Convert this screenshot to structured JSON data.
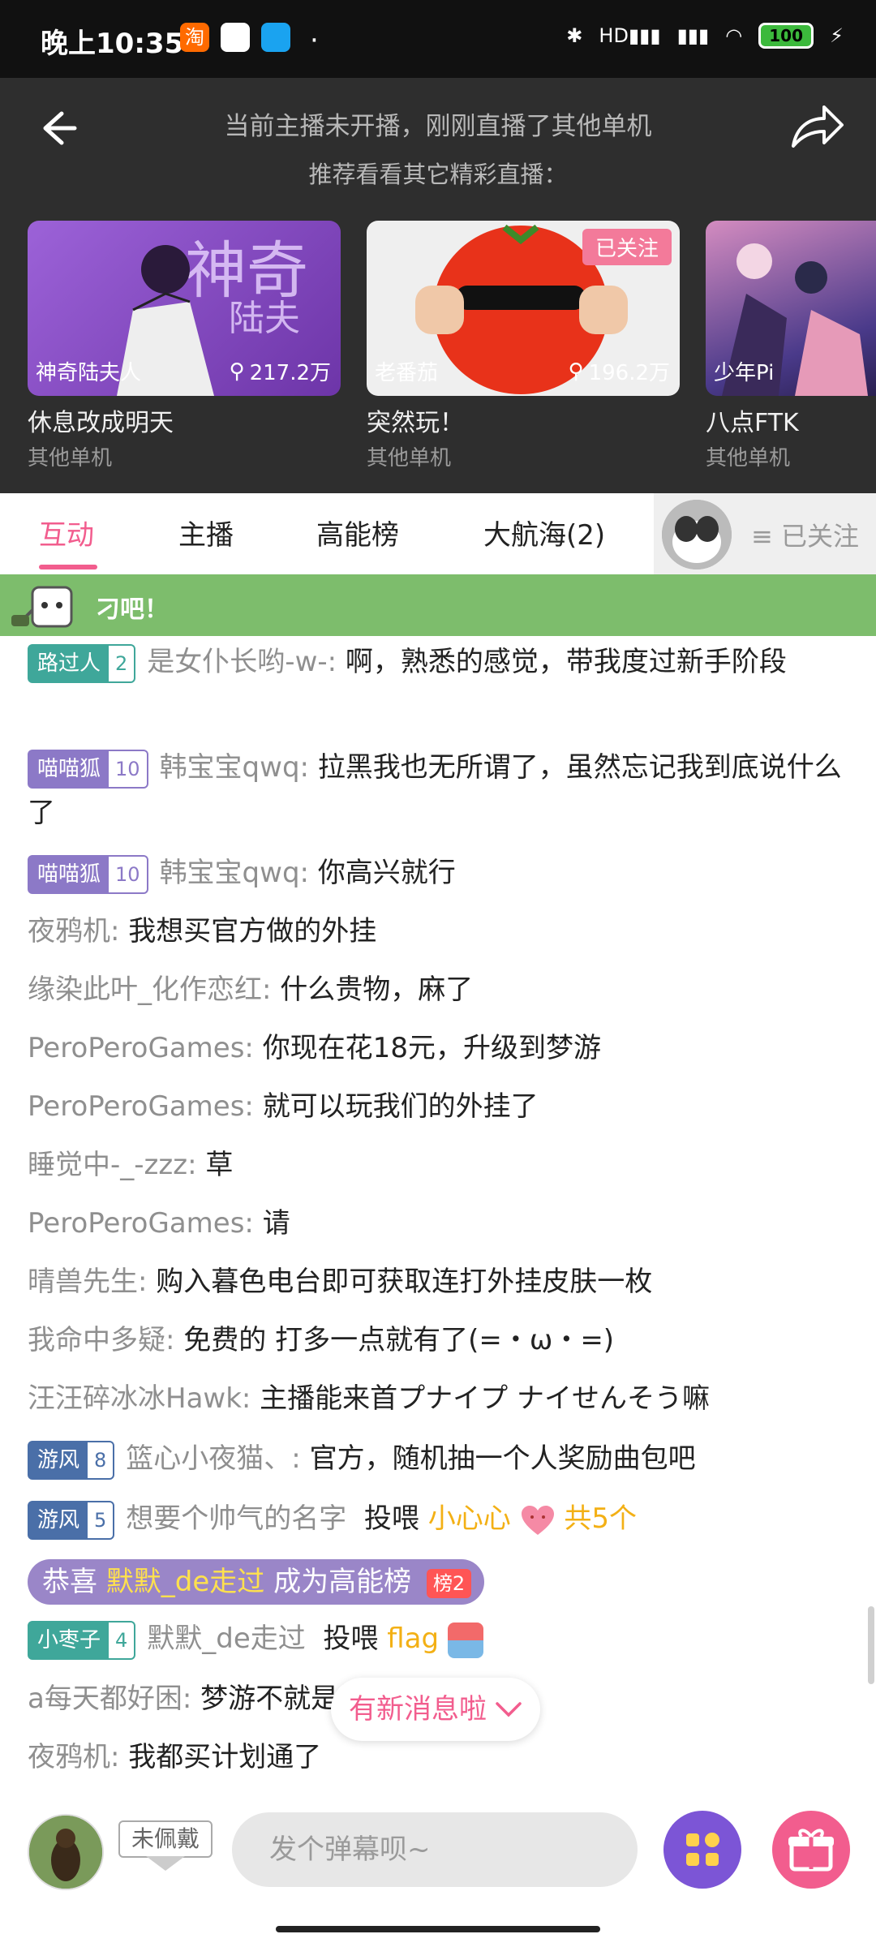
{
  "status_bar": {
    "time": "晚上10:35",
    "battery": "100",
    "network": "HD"
  },
  "header": {
    "line1": "当前主播未开播，刚刚直播了其他单机",
    "line2": "推荐看看其它精彩直播："
  },
  "recommendations": [
    {
      "streamer": "神奇陆夫人",
      "views": "217.2万",
      "title": "休息改成明天",
      "category": "其他单机",
      "art_text": "神奇",
      "art_text2": "陆夫"
    },
    {
      "streamer": "老番茄",
      "views": "196.2万",
      "title": "突然玩！",
      "category": "其他单机",
      "tag": "已关注"
    },
    {
      "streamer": "少年Pi",
      "title": "八点FTK",
      "category": "其他单机"
    }
  ],
  "tabs": [
    "互动",
    "主播",
    "高能榜",
    "大航海(2)"
  ],
  "follow_label": "≡ 已关注",
  "banner_text": "刁吧！",
  "chat": [
    {
      "badge": "路过人",
      "level": "2",
      "user": "是女仆长哟-w-:",
      "text": "啊，熟悉的感觉，带我度过新手阶段"
    },
    {
      "badge": "喵喵狐",
      "level": "10",
      "user": "韩宝宝qwq:",
      "text": "拉黑我也无所谓了，虽然忘记我到底说什么了"
    },
    {
      "badge": "喵喵狐",
      "level": "10",
      "user": "韩宝宝qwq:",
      "text": "你高兴就行"
    },
    {
      "user": "夜鸦机:",
      "text": "我想买官方做的外挂"
    },
    {
      "user": "缘染此叶_化作恋红:",
      "text": "什么贵物，麻了"
    },
    {
      "user": "PeroPeroGames:",
      "text": "你现在花18元，升级到梦游"
    },
    {
      "user": "PeroPeroGames:",
      "text": "就可以玩我们的外挂了"
    },
    {
      "user": "睡觉中-_-zzz:",
      "text": "草"
    },
    {
      "user": "PeroPeroGames:",
      "text": "请"
    },
    {
      "user": "晴兽先生:",
      "text": "购入暮色电台即可获取连打外挂皮肤一枚"
    },
    {
      "user": "我命中多疑:",
      "text": "免费的   打多一点就有了(=・ω・=)"
    },
    {
      "user": "汪汪碎冰冰Hawk:",
      "text": "主播能来首プナイプ ナイせんそう嘛"
    },
    {
      "badge": "游风",
      "level": "8",
      "user": "篮心小夜猫、:",
      "text": "官方，随机抽一个人奖励曲包吧"
    },
    {
      "badge": "游风",
      "level": "5",
      "user": "想要个帅气的名字",
      "action": "投喂",
      "gift": "小心心",
      "count": "共5个"
    },
    {
      "badge": "小枣子",
      "level": "4",
      "user": "默默_de走过",
      "action": "投喂",
      "gift": "flag"
    },
    {
      "user": "a每天都好困:",
      "text": "梦游不就是钱么（(・∀・)_"
    },
    {
      "user": "夜鸦机:",
      "text": "我都买计划通了"
    }
  ],
  "notice": {
    "prefix": "恭喜",
    "user": "默默_de走过",
    "text": "成为高能榜",
    "rank": "榜2"
  },
  "new_message_pill": "有新消息啦",
  "bottom": {
    "medal": "未佩戴",
    "placeholder": "发个弹幕呗~"
  },
  "colors": {
    "accent_pink": "#f25d8e",
    "badge_teal": "#3fa79a",
    "badge_purple": "#8c79c7",
    "badge_blue": "#4a6fa8",
    "banner_green": "#7dbd6c",
    "gold": "#f3b015"
  }
}
